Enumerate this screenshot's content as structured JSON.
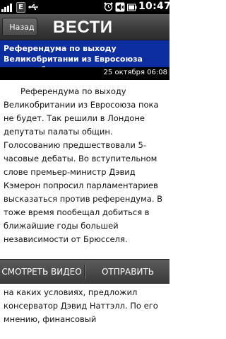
{
  "status_bar": {
    "network_badge": "E",
    "time": "10:47",
    "icons": [
      "signal-icon",
      "usb-icon",
      "alarm-clock-icon",
      "mute-icon",
      "battery-icon"
    ]
  },
  "header": {
    "back_label": "Назад",
    "brand": "ВЕСТИ"
  },
  "article": {
    "title": "Референдума по выходу Великобритании из Евросоюза пока не будет",
    "date": "25 октября 06:08",
    "paragraphs": [
      "Референдума по выходу Великобритании из Евросоюза пока не будет. Так решили в Лондоне депутаты палаты общин. Голосованию предшествовали 5-часовые дебаты. Во вступительном слове премьер-министр Дэвид Кэмерон попросил парламентариев высказаться против референдума. В тоже время пообещал добиться в ближайшие годы большей независимости от Брюсселя.",
      "Решить вопрос о том, останется ли страна в составе ЕС и если да, то на каких условиях, предложил консерватор Дэвид Наттэлл. По его мнению, финансовый"
    ]
  },
  "softkeys": {
    "left": "СМОТРЕТЬ ВИДЕО",
    "right": "ОТПРАВИТЬ"
  },
  "colors": {
    "title_bar": "#0c2ea0",
    "header": "#3b3b3b",
    "status_bar": "#000000"
  }
}
